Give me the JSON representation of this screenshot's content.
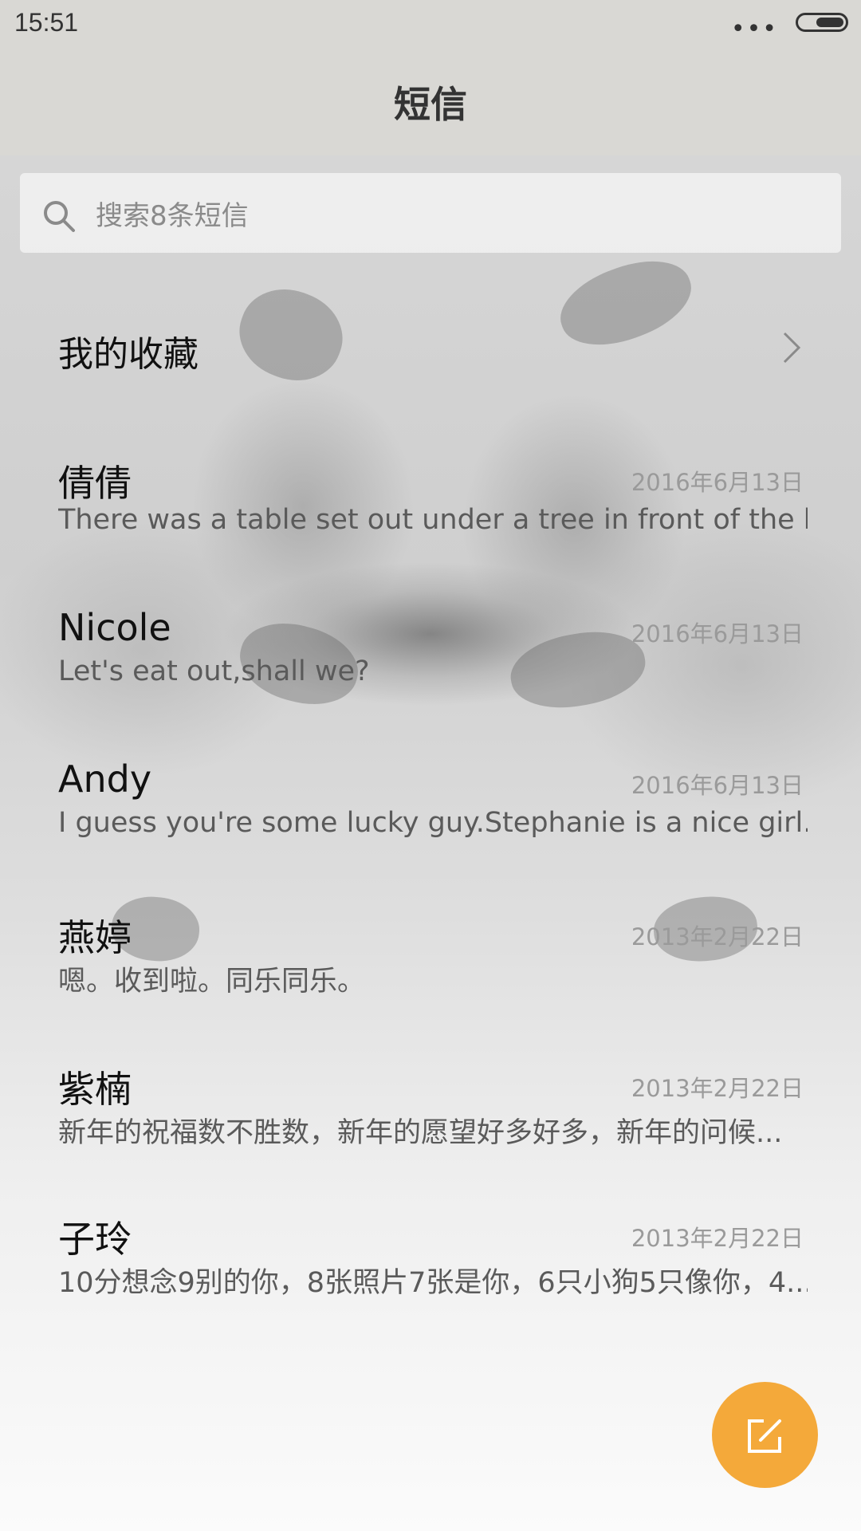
{
  "status_bar": {
    "time": "15:51",
    "signal_dots": "•••"
  },
  "header": {
    "title": "短信"
  },
  "search": {
    "placeholder": "搜索8条短信"
  },
  "favorites": {
    "label": "我的收藏"
  },
  "messages": [
    {
      "name": "倩倩",
      "date": "2016年6月13日",
      "preview": "There was a table set out under a tree in front of the ho.."
    },
    {
      "name": "Nicole",
      "date": "2016年6月13日",
      "preview": "Let's eat out,shall we?"
    },
    {
      "name": "Andy",
      "date": "2016年6月13日",
      "preview": "I guess you're some lucky guy.Stephanie is a nice girl."
    },
    {
      "name": "燕婷",
      "date": "2013年2月22日",
      "preview": "嗯。收到啦。同乐同乐。"
    },
    {
      "name": "紫楠",
      "date": "2013年2月22日",
      "preview": "新年的祝福数不胜数，新年的愿望好多好多，新年的问候..."
    },
    {
      "name": "子玲",
      "date": "2013年2月22日",
      "preview": "10分想念9别的你，8张照片7张是你，6只小狗5只像你，4..."
    }
  ],
  "fab": {
    "icon": "compose-icon",
    "color": "#f4a93a"
  },
  "colors": {
    "header_bg": "#d9d8d4",
    "title_text": "#333333",
    "name_text": "#111111",
    "preview_text": "#5a5a5a",
    "date_text": "#9a9a9a"
  }
}
